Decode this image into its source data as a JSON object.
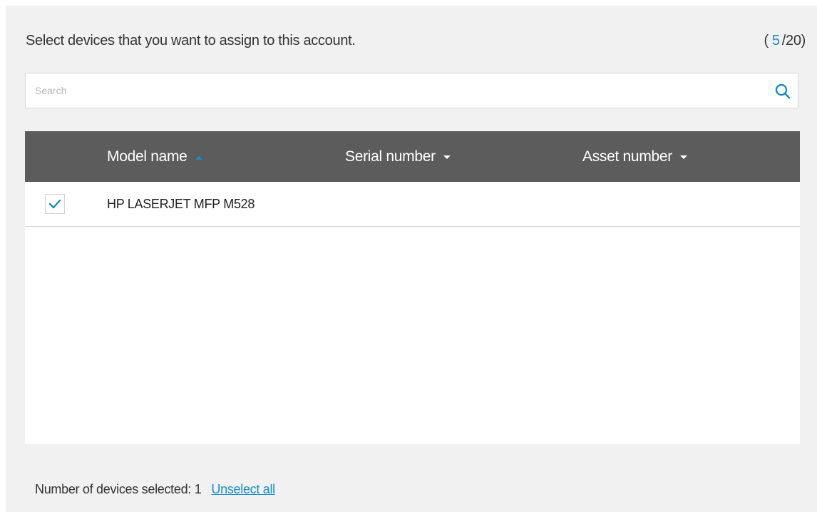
{
  "header": {
    "instruction": "Select devices that you want to assign to this account.",
    "counter_prefix": "(",
    "counter_current": "5",
    "counter_suffix": "/20)"
  },
  "search": {
    "placeholder": "Search",
    "value": "",
    "icon": "search-icon"
  },
  "table": {
    "columns": [
      {
        "label": "Model name",
        "sort": "ascending",
        "icon": "sort-up-icon"
      },
      {
        "label": "Serial number",
        "sort": "none",
        "icon": "caret-down-icon"
      },
      {
        "label": "Asset number",
        "sort": "none",
        "icon": "caret-down-icon"
      }
    ],
    "rows": [
      {
        "checked": true,
        "model": "HP LASERJET MFP M528",
        "serial": "",
        "asset": ""
      }
    ]
  },
  "footer": {
    "selected_label": "Number of devices selected: 1",
    "unselect_all": "Unselect all"
  },
  "colors": {
    "accent": "#1a8bc7",
    "header_bg": "#5c5c5c",
    "panel_bg": "#f1f1f1"
  }
}
